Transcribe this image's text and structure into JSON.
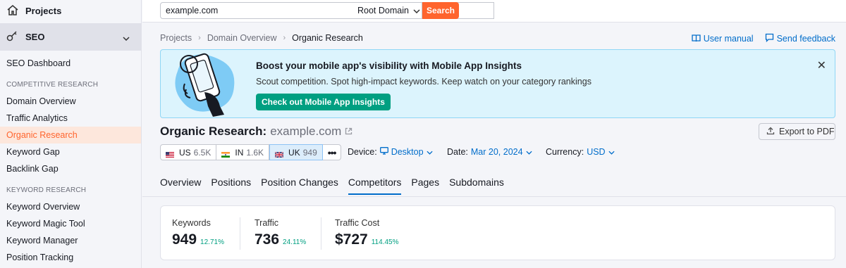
{
  "sidebar": {
    "projects_label": "Projects",
    "seo_label": "SEO",
    "dashboard": "SEO Dashboard",
    "sections": [
      {
        "title": "COMPETITIVE RESEARCH",
        "items": [
          "Domain Overview",
          "Traffic Analytics",
          "Organic Research",
          "Keyword Gap",
          "Backlink Gap"
        ]
      },
      {
        "title": "KEYWORD RESEARCH",
        "items": [
          "Keyword Overview",
          "Keyword Magic Tool",
          "Keyword Manager",
          "Position Tracking"
        ]
      }
    ],
    "active_item": "Organic Research"
  },
  "search": {
    "value": "example.com",
    "scope": "Root Domain",
    "button": "Search"
  },
  "breadcrumb": [
    "Projects",
    "Domain Overview",
    "Organic Research"
  ],
  "top_links": {
    "manual": "User manual",
    "feedback": "Send feedback"
  },
  "banner": {
    "title": "Boost your mobile app's visibility with Mobile App Insights",
    "text": "Scout competition. Spot high-impact keywords. Keep watch on your category rankings",
    "button": "Check out Mobile App Insights"
  },
  "page": {
    "title": "Organic Research:",
    "domain": "example.com",
    "export": "Export to PDF"
  },
  "databases": [
    {
      "code": "US",
      "count": "6.5K"
    },
    {
      "code": "IN",
      "count": "1.6K"
    },
    {
      "code": "UK",
      "count": "949"
    }
  ],
  "filters": {
    "device_label": "Device:",
    "device_value": "Desktop",
    "date_label": "Date:",
    "date_value": "Mar 20, 2024",
    "currency_label": "Currency:",
    "currency_value": "USD"
  },
  "tabs": [
    "Overview",
    "Positions",
    "Position Changes",
    "Competitors",
    "Pages",
    "Subdomains"
  ],
  "active_tab": "Competitors",
  "stats": [
    {
      "label": "Keywords",
      "value": "949",
      "change": "12.71%"
    },
    {
      "label": "Traffic",
      "value": "736",
      "change": "24.11%"
    },
    {
      "label": "Traffic Cost",
      "value": "$727",
      "change": "114.45%"
    }
  ],
  "colors": {
    "accent": "#ff642d",
    "link": "#006dca",
    "positive": "#009f81"
  }
}
